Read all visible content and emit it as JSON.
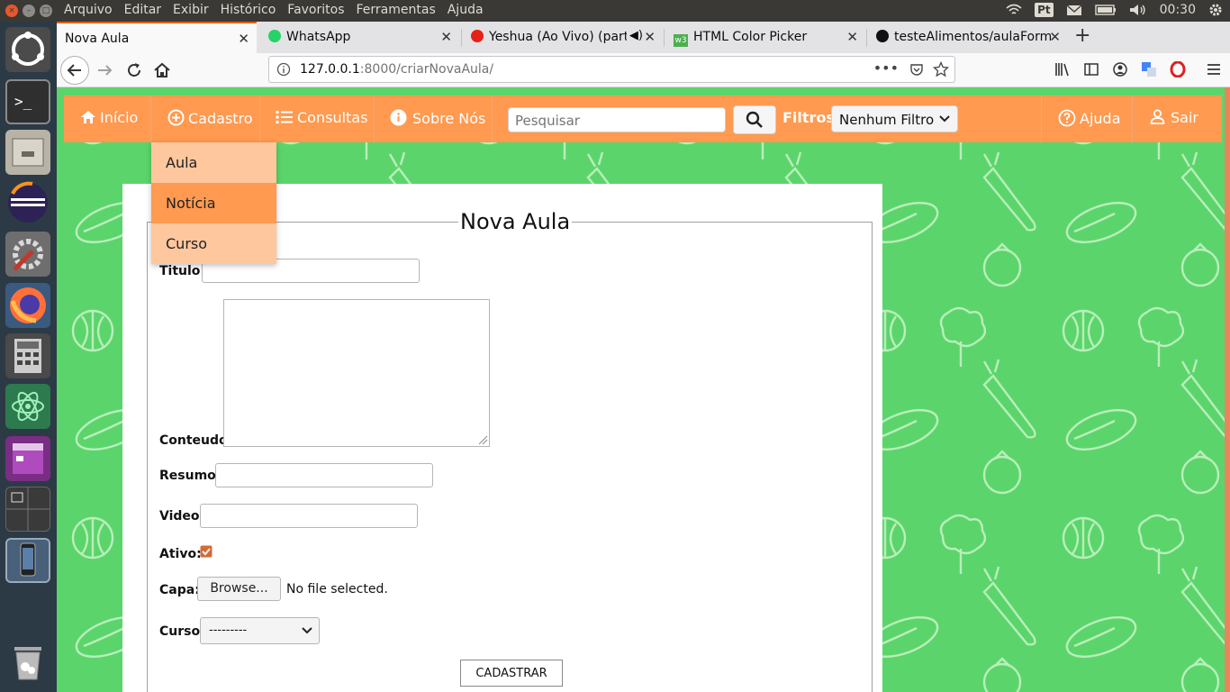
{
  "system": {
    "menu": [
      "Arquivo",
      "Editar",
      "Exibir",
      "Histórico",
      "Favoritos",
      "Ferramentas",
      "Ajuda"
    ],
    "tray": {
      "keyboard_layout": "Pt",
      "clock": "00:30"
    }
  },
  "browser": {
    "tabs": [
      {
        "title": "Nova Aula"
      },
      {
        "title": "WhatsApp"
      },
      {
        "title": "Yeshua (Ao Vivo) (part"
      },
      {
        "title": "HTML Color Picker"
      },
      {
        "title": "testeAlimentos/aulaForm"
      }
    ],
    "url": {
      "host": "127.0.0.1",
      "rest": ":8000/criarNovaAula/"
    }
  },
  "site": {
    "nav": {
      "inicio": "Início",
      "cadastro": "Cadastro",
      "consultas": "Consultas",
      "sobre": "Sobre Nós",
      "search_placeholder": "Pesquisar",
      "filtros": "Filtros",
      "filter_value": "Nenhum Filtro",
      "ajuda": "Ajuda",
      "sair": "Sair"
    },
    "dropdown": [
      "Aula",
      "Notícia",
      "Curso"
    ],
    "form": {
      "legend": "Nova Aula",
      "titulo": "Titulo:",
      "conteudo": "Conteudo:",
      "resumo": "Resumo:",
      "video": "Video:",
      "ativo": "Ativo:",
      "capa": "Capa:",
      "browse": "Browse...",
      "no_file": "No file selected.",
      "curso": "Curso:",
      "curso_value": "---------",
      "submit": "CADASTRAR"
    }
  },
  "colors": {
    "nav": "#ff9a50",
    "background": "#5bd56b",
    "dropdown_light": "#ffc79e",
    "dropdown_active": "#ff9a50",
    "checkbox": "#d46a35"
  }
}
